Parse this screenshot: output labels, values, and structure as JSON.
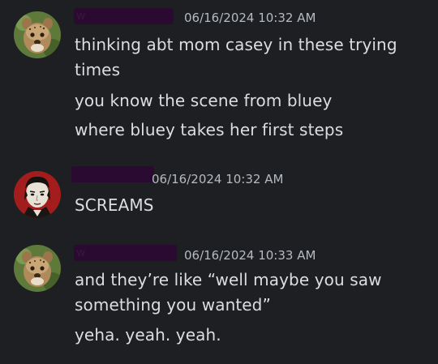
{
  "messages": [
    {
      "author_obscured": "w",
      "timestamp": "06/16/2024 10:32 AM",
      "lines": [
        "thinking abt mom casey in these trying",
        "times",
        "you know the scene from bluey",
        "where bluey takes her first steps"
      ],
      "avatar_icon": "cheetah-cub-avatar-icon"
    },
    {
      "author_obscured": "",
      "timestamp": "06/16/2024 10:32 AM",
      "lines": [
        "SCREAMS"
      ],
      "avatar_icon": "cartoon-character-avatar-icon"
    },
    {
      "author_obscured": "w",
      "timestamp": "06/16/2024 10:33 AM",
      "lines": [
        "and they’re like “well maybe you saw",
        "something you wanted”",
        "yeha. yeah. yeah."
      ],
      "avatar_icon": "cheetah-cub-avatar-icon"
    }
  ],
  "colors": {
    "background": "#1e1f22",
    "text": "#dbdee1",
    "timestamp": "#b5bac1",
    "username_redaction": "#2a0a30"
  }
}
